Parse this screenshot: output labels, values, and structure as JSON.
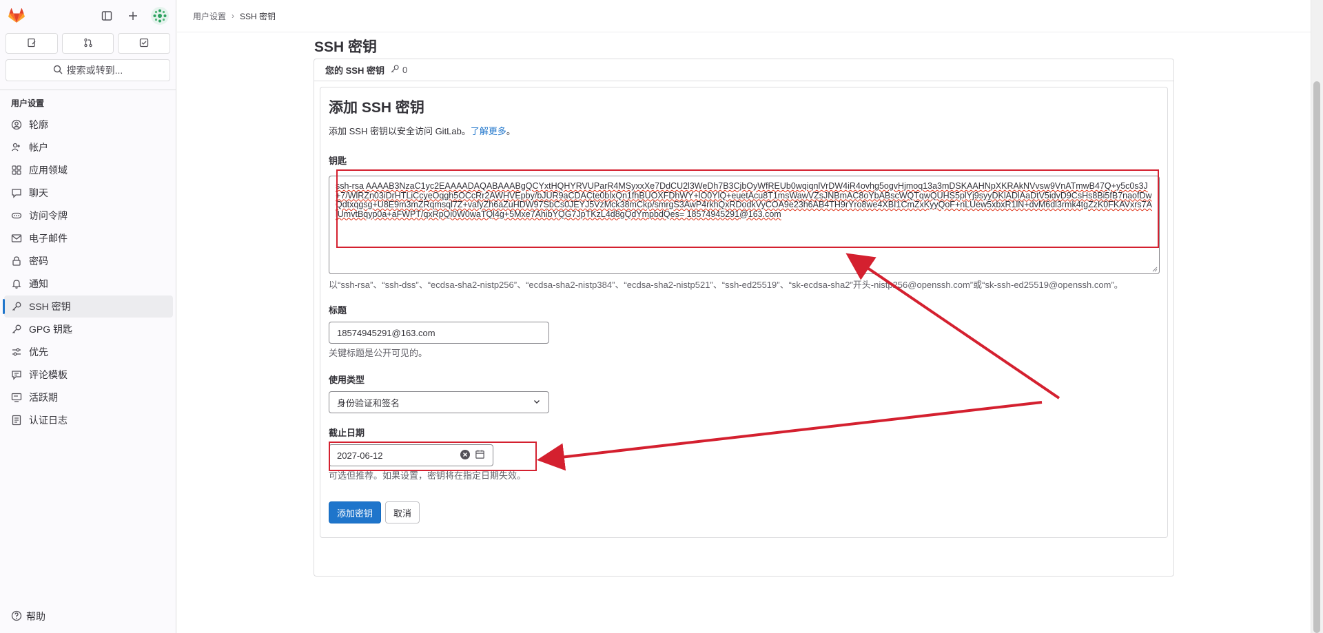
{
  "sidebar": {
    "section_title": "用户设置",
    "search_label": "搜索或转到...",
    "items": [
      {
        "label": "轮廓",
        "icon": "user-circle-icon"
      },
      {
        "label": "帐户",
        "icon": "account-icon"
      },
      {
        "label": "应用领域",
        "icon": "applications-icon"
      },
      {
        "label": "聊天",
        "icon": "comment-icon"
      },
      {
        "label": "访问令牌",
        "icon": "token-icon"
      },
      {
        "label": "电子邮件",
        "icon": "mail-icon"
      },
      {
        "label": "密码",
        "icon": "lock-icon"
      },
      {
        "label": "通知",
        "icon": "bell-icon"
      },
      {
        "label": "SSH 密钥",
        "icon": "key-icon",
        "active": true
      },
      {
        "label": "GPG 钥匙",
        "icon": "key-icon"
      },
      {
        "label": "优先",
        "icon": "preferences-icon"
      },
      {
        "label": "评论模板",
        "icon": "comment-template-icon"
      },
      {
        "label": "活跃期",
        "icon": "monitor-icon"
      },
      {
        "label": "认证日志",
        "icon": "log-icon"
      }
    ],
    "help_label": "帮助"
  },
  "breadcrumb": {
    "parent": "用户设置",
    "current": "SSH 密钥"
  },
  "page": {
    "title": "SSH 密钥",
    "your_keys_label": "您的 SSH 密钥",
    "your_keys_count": "0"
  },
  "form": {
    "title": "添加 SSH 密钥",
    "description": "添加 SSH 密钥以安全访问 GitLab。",
    "learn_more": "了解更多",
    "description_end": "。",
    "key_label": "钥匙",
    "key_value": "ssh-rsa AAAAB3NzaC1yc2EAAAADAQABAAABgQCYxtHQHYRVUParR4MSyxxXe7DdCU2l3WeDh7B3CjbOyWfREUb0wqiqnlVrDW4iR4ovhg5ogvHjmoq13a3mDSKAAHNpXKRAkNVvsw9VnATmwB47Q+y5c0s3J+7/WlRZn03iDrHTLiCcyeOqgh5OCcRr2AWHVEpby/bJUR9aCDACte0blxQn1fhBUOXFDhWY+lO0YlQ+euetAcu8T1msWawVZsJNBmAC8oYbABscWQTqwQUHS5plYj9syyDKlADlAaDtV5idvD9CsHs8Bi5fB7naofDwQdtxqgsg+U8E9m3mZRqmsql7Z+vafyZh6aZuHDW97SbCs0JEYJ5VzMck38mCkp/smrgS3AwP4rkhQxRDodkVyCOA9e23h6AB4TH9rYro8we4XBI1CmZxKyyQoF+nLUew5xbxR1lN+dvM6dl3rmk4tgZzK0FKAVxrs7AlUmvtBqyp0a+aFWPT/qxRpQi0W0waTQl4g+5Mxe7AhibYQG7JpTKzL4d8gQdYmpbdQes= 18574945291@163.com",
    "key_help": "以“ssh-rsa”、“ssh-dss”、“ecdsa-sha2-nistp256”、“ecdsa-sha2-nistp384”、“ecdsa-sha2-nistp521”、“ssh-ed25519”、“sk-ecdsa-sha2”开头-nistp256@openssh.com”或“sk-ssh-ed25519@openssh.com”。",
    "title_label": "标题",
    "title_value": "18574945291@163.com",
    "title_help": "关键标题是公开可见的。",
    "usage_label": "使用类型",
    "usage_value": "身份验证和签名",
    "expiry_label": "截止日期",
    "expiry_value": "2027-06-12",
    "expiry_help": "可选但推荐。如果设置，密钥将在指定日期失效。",
    "submit_label": "添加密钥",
    "cancel_label": "取消"
  },
  "colors": {
    "primary": "#1f75cb",
    "annotation": "#d4202f",
    "logo": "#e24329"
  }
}
